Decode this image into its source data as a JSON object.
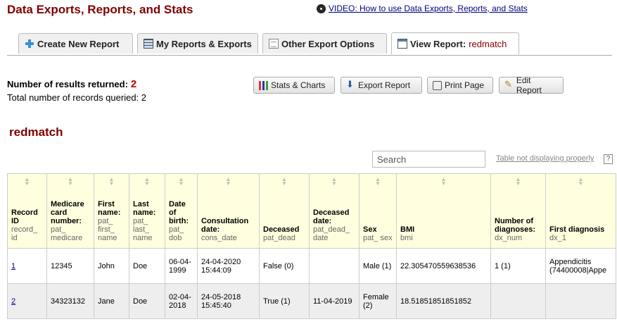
{
  "page": {
    "title": "Data Exports, Reports, and Stats",
    "video_link": "VIDEO: How to use Data Exports, Reports, and Stats"
  },
  "tabs": [
    {
      "label": "Create New Report",
      "icon": "plus-icon"
    },
    {
      "label": "My Reports & Exports",
      "icon": "reports-icon"
    },
    {
      "label": "Other Export Options",
      "icon": "document-icon"
    },
    {
      "label": "View Report:",
      "report_name": "redmatch",
      "icon": "window-icon",
      "active": true
    }
  ],
  "results": {
    "returned_label": "Number of results returned:",
    "returned_value": "2",
    "queried_label": "Total number of records queried:",
    "queried_value": "2"
  },
  "buttons": {
    "stats": "Stats & Charts",
    "export": "Export Report",
    "print": "Print Page",
    "edit": "Edit Report"
  },
  "report": {
    "name": "redmatch",
    "search_placeholder": "Search",
    "table_help": "Table not displaying properly",
    "help_icon": "?"
  },
  "columns": [
    {
      "label": "Record ID",
      "var": "record_ id"
    },
    {
      "label": "Medicare card number:",
      "var": "pat_ medicare"
    },
    {
      "label": "First name:",
      "var": "pat_ first_ name"
    },
    {
      "label": "Last name:",
      "var": "pat_ last_ name"
    },
    {
      "label": "Date of birth:",
      "var": "pat_ dob"
    },
    {
      "label": "Consultation date:",
      "var": "cons_date"
    },
    {
      "label": "Deceased",
      "var": "pat_dead"
    },
    {
      "label": "Deceased date:",
      "var": "pat_dead_ date"
    },
    {
      "label": "Sex",
      "var": "pat_ sex"
    },
    {
      "label": "BMI",
      "var": "bmi"
    },
    {
      "label": "Number of diagnoses:",
      "var": "dx_num"
    },
    {
      "label": "First diagnosis",
      "var": "dx_1"
    }
  ],
  "rows": [
    [
      "1",
      "12345",
      "John",
      "Doe",
      "06-04-1999",
      "24-04-2020 15:44:09",
      "False (0)",
      "",
      "Male (1)",
      "22.305470559638536",
      "1 (1)",
      "Appendicitis (74400008|Appe"
    ],
    [
      "2",
      "34323132",
      "Jane",
      "Doe",
      "02-04-2018",
      "24-05-2018 15:45:40",
      "True (1)",
      "11-04-2019",
      "Female (2)",
      "18.51851851851852",
      "",
      ""
    ]
  ]
}
